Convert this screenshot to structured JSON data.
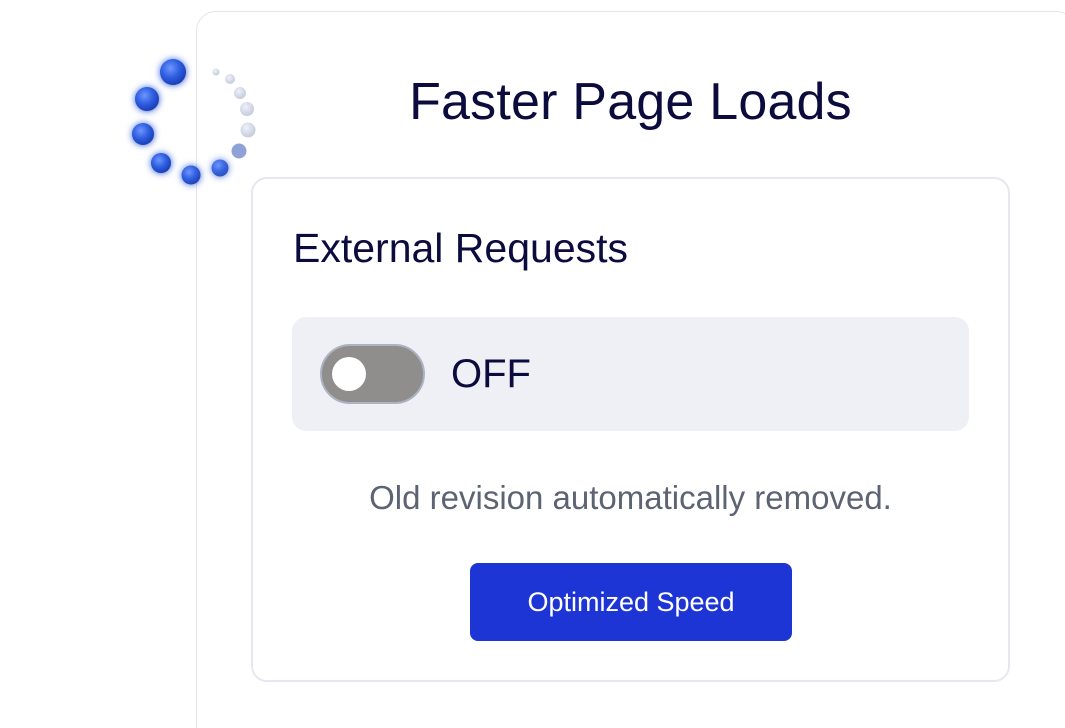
{
  "page": {
    "title": "Faster Page Loads"
  },
  "section": {
    "title": "External Requests",
    "toggle": {
      "state_label": "OFF",
      "on": false
    },
    "status_text": "Old revision automatically removed.",
    "action_label": "Optimized Speed"
  },
  "decoration": {
    "icon": "loading-spinner-icon",
    "accent_color": "#1d35d5"
  }
}
